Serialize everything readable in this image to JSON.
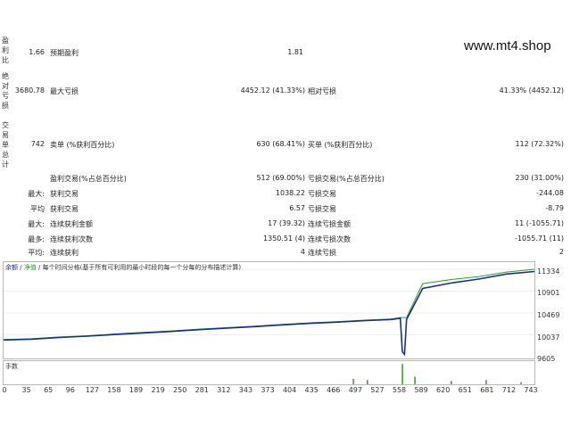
{
  "watermark": "www.mt4.shop",
  "sections": {
    "profit_factor_label": [
      "盈",
      "利",
      "比"
    ],
    "absolute_drawdown_label": [
      "绝",
      "对",
      "亏",
      "损"
    ],
    "trades_summary_label": [
      "交",
      "易",
      "单",
      "总",
      "计"
    ]
  },
  "row1": {
    "value": "1.66",
    "label": "预期盈利",
    "value2": "1.81"
  },
  "row2": {
    "value": "3680.78",
    "label": "最大亏损",
    "value2": "4452.12 (41.33%)",
    "label3": "相对亏损",
    "value3": "41.33% (4452.12)"
  },
  "row3": {
    "value": "742",
    "label": "卖单 (%获利百分比)",
    "value2": "630 (68.41%)",
    "label3": "买单 (%获利百分比)",
    "value3": "112 (72.32%)"
  },
  "stats": [
    {
      "prefix": "",
      "label": "盈利交易(%占总百分比)",
      "value": "512 (69.00%)",
      "label2": "亏损交易(%占总百分比)",
      "value2": "230 (31.00%)"
    },
    {
      "prefix": "最大:",
      "label": "获利交易",
      "value": "1038.22",
      "label2": "亏损交易",
      "value2": "-244.08"
    },
    {
      "prefix": "平均",
      "label": "获利交易",
      "value": "6.57",
      "label2": "亏损交易",
      "value2": "-8.79"
    },
    {
      "prefix": "最大:",
      "label": "连续获利金额",
      "value": "17 (39.32)",
      "label2": "连续亏损金额",
      "value2": "11 (-1055.71)"
    },
    {
      "prefix": "最多:",
      "label": "连续获利次数",
      "value": "1350.51 (4)",
      "label2": "连续亏损次数",
      "value2": "-1055.71 (11)"
    },
    {
      "prefix": "平均:",
      "label": "连续获利",
      "value": "4",
      "label2": "连续亏损",
      "value2": "2"
    }
  ],
  "chart": {
    "legend_balance": "余额",
    "legend_equity": "净值",
    "legend_desc": "每个时间分格(基于所有可利用的最小时段的每一个分每的分布描述计算)",
    "volume_label": "手数",
    "y_ticks": [
      "11334",
      "10901",
      "10469",
      "10037",
      "9605"
    ],
    "x_ticks": [
      "0",
      "35",
      "65",
      "96",
      "127",
      "158",
      "189",
      "219",
      "250",
      "281",
      "312",
      "343",
      "373",
      "404",
      "435",
      "466",
      "497",
      "527",
      "558",
      "589",
      "620",
      "651",
      "681",
      "712",
      "743"
    ],
    "colors": {
      "balance": "#1a2f8a",
      "equity": "#2aa02a",
      "volume": "#2aa02a"
    }
  },
  "chart_data": {
    "type": "line",
    "x_range": [
      0,
      760
    ],
    "ylim": [
      9605,
      11334
    ],
    "series": [
      {
        "name": "余额",
        "points": [
          [
            0,
            9935
          ],
          [
            40,
            9950
          ],
          [
            80,
            9985
          ],
          [
            120,
            10010
          ],
          [
            160,
            10045
          ],
          [
            200,
            10075
          ],
          [
            240,
            10105
          ],
          [
            280,
            10140
          ],
          [
            320,
            10170
          ],
          [
            360,
            10200
          ],
          [
            400,
            10235
          ],
          [
            440,
            10265
          ],
          [
            480,
            10290
          ],
          [
            520,
            10320
          ],
          [
            555,
            10340
          ],
          [
            568,
            10365
          ],
          [
            571,
            9700
          ],
          [
            574,
            9650
          ],
          [
            577,
            10340
          ],
          [
            600,
            10955
          ],
          [
            640,
            11060
          ],
          [
            680,
            11140
          ],
          [
            720,
            11240
          ],
          [
            760,
            11290
          ]
        ]
      },
      {
        "name": "净值",
        "points": [
          [
            0,
            9945
          ],
          [
            40,
            9960
          ],
          [
            80,
            9995
          ],
          [
            120,
            10020
          ],
          [
            160,
            10055
          ],
          [
            200,
            10085
          ],
          [
            240,
            10115
          ],
          [
            280,
            10150
          ],
          [
            320,
            10180
          ],
          [
            360,
            10210
          ],
          [
            400,
            10245
          ],
          [
            440,
            10275
          ],
          [
            480,
            10300
          ],
          [
            520,
            10330
          ],
          [
            555,
            10350
          ],
          [
            568,
            10380
          ],
          [
            577,
            10380
          ],
          [
            600,
            11050
          ],
          [
            640,
            11130
          ],
          [
            680,
            11190
          ],
          [
            720,
            11280
          ],
          [
            760,
            11334
          ]
        ]
      }
    ],
    "volume_spikes": [
      [
        500,
        0.25
      ],
      [
        520,
        0.2
      ],
      [
        570,
        0.95
      ],
      [
        588,
        0.35
      ],
      [
        640,
        0.15
      ],
      [
        690,
        0.2
      ],
      [
        740,
        0.1
      ]
    ]
  }
}
